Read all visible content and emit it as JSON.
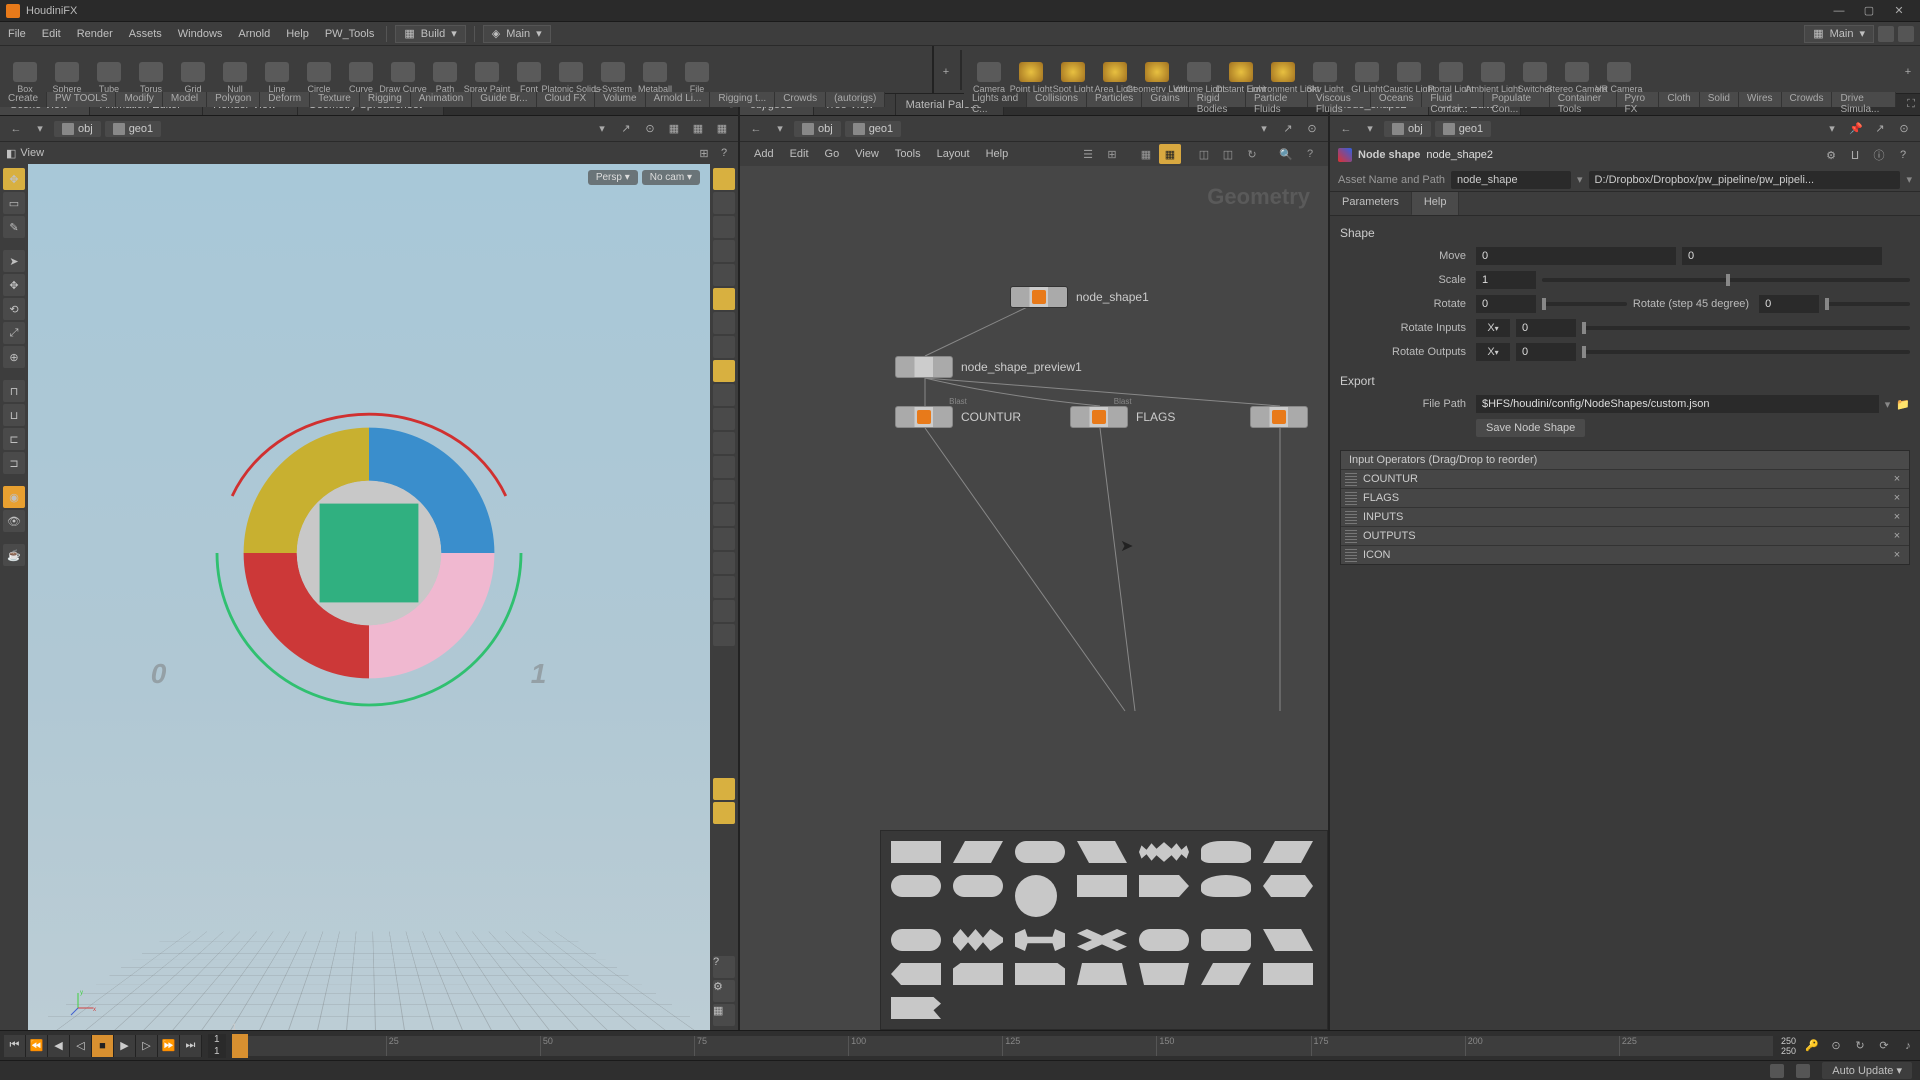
{
  "app": {
    "title": "HoudiniFX"
  },
  "window": {
    "minimize": "—",
    "maximize": "▢",
    "close": "✕"
  },
  "menus": [
    "File",
    "Edit",
    "Render",
    "Assets",
    "Windows",
    "Arnold",
    "Help",
    "PW_Tools"
  ],
  "desktops": {
    "left": "Build",
    "right": "Main",
    "far_right": "Main"
  },
  "shelves": {
    "left_tabs": [
      "Create",
      "PW TOOLS",
      "Modify",
      "Model",
      "Polygon",
      "Deform",
      "Texture",
      "Rigging",
      "Animation",
      "Guide Br...",
      "Cloud FX",
      "Volume",
      "Arnold Li...",
      "Rigging t...",
      "Crowds",
      "(autorigs)"
    ],
    "left_tools": [
      {
        "k": "box",
        "label": "Box"
      },
      {
        "k": "sphere",
        "label": "Sphere"
      },
      {
        "k": "tube",
        "label": "Tube"
      },
      {
        "k": "torus",
        "label": "Torus"
      },
      {
        "k": "grid",
        "label": "Grid"
      },
      {
        "k": "null",
        "label": "Null"
      },
      {
        "k": "line",
        "label": "Line"
      },
      {
        "k": "circle",
        "label": "Circle"
      },
      {
        "k": "curve",
        "label": "Curve"
      },
      {
        "k": "drawcurve",
        "label": "Draw Curve"
      },
      {
        "k": "path",
        "label": "Path"
      },
      {
        "k": "spraypaint",
        "label": "Spray Paint"
      },
      {
        "k": "font",
        "label": "Font"
      },
      {
        "k": "platonic",
        "label": "Platonic Solids"
      },
      {
        "k": "lsystem",
        "label": "L-System"
      },
      {
        "k": "metaball",
        "label": "Metaball"
      },
      {
        "k": "file",
        "label": "File"
      }
    ],
    "right_tabs": [
      "Lights and C...",
      "Collisions",
      "Particles",
      "Grains",
      "Rigid Bodies",
      "Particle Fluids",
      "Viscous Fluids",
      "Oceans",
      "Fluid Contai...",
      "Populate Con...",
      "Container Tools",
      "Pyro FX",
      "Cloth",
      "Solid",
      "Wires",
      "Crowds",
      "Drive Simula..."
    ],
    "right_tools": [
      {
        "k": "camera",
        "label": "Camera"
      },
      {
        "k": "pointlight",
        "label": "Point Light",
        "hl": true
      },
      {
        "k": "spotlight",
        "label": "Spot Light",
        "hl": true
      },
      {
        "k": "arealight",
        "label": "Area Light",
        "hl": true
      },
      {
        "k": "geolight",
        "label": "Geometry Light",
        "hl": true
      },
      {
        "k": "volumelight",
        "label": "Volume Light"
      },
      {
        "k": "distantlight",
        "label": "Distant Light",
        "hl": true
      },
      {
        "k": "envlight",
        "label": "Environment Light",
        "hl": true
      },
      {
        "k": "skylight",
        "label": "Sky Light"
      },
      {
        "k": "gilight",
        "label": "GI Light"
      },
      {
        "k": "causticlight",
        "label": "Caustic Light"
      },
      {
        "k": "portallight",
        "label": "Portal Light"
      },
      {
        "k": "ambientlight",
        "label": "Ambient Light"
      },
      {
        "k": "switcher",
        "label": "Switcher"
      },
      {
        "k": "stereocam",
        "label": "Stereo Camera"
      },
      {
        "k": "vrcamera",
        "label": "VR Camera"
      }
    ]
  },
  "tabs_left": [
    "Scene View",
    "Animation Editor",
    "Render View",
    "Geometry Spreadsheet"
  ],
  "tabs_mid": [
    "obj/geo1",
    "Tree View",
    "Material Palette"
  ],
  "tabs_right": [
    "node_shape2",
    "Script Editor"
  ],
  "path_left": {
    "seg1": "obj",
    "seg2": "geo1"
  },
  "path_mid": {
    "seg1": "obj",
    "seg2": "geo1"
  },
  "path_right": {
    "seg1": "obj",
    "seg2": "geo1"
  },
  "scene": {
    "view_label": "View",
    "persp": "Persp ▾",
    "nocam": "No cam ▾",
    "label0": "0",
    "label1": "1"
  },
  "network": {
    "menus": [
      "Add",
      "Edit",
      "Go",
      "View",
      "Tools",
      "Layout",
      "Help"
    ],
    "watermark": "Geometry",
    "nodes": {
      "n1": "node_shape1",
      "n2": "node_shape_preview1",
      "n3": "COUNTUR",
      "n4": "FLAGS",
      "sub3": "Blast",
      "sub4": "Blast"
    }
  },
  "parm": {
    "type": "Node shape",
    "name": "node_shape2",
    "anp_label": "Asset Name and Path",
    "asset_name": "node_shape",
    "asset_path": "D:/Dropbox/Dropbox/pw_pipeline/pw_pipeli...",
    "tabs": [
      "Parameters",
      "Help"
    ],
    "sec_shape": "Shape",
    "row_move": "Move",
    "move_x": "0",
    "move_y": "0",
    "row_scale": "Scale",
    "scale_v": "1",
    "row_rotate": "Rotate",
    "rotate_v": "0",
    "rotate_step_lbl": "Rotate (step 45 degree)",
    "rotate_step_v": "0",
    "row_rotin": "Rotate Inputs",
    "rotin_axis": "X",
    "rotin_v": "0",
    "row_rotout": "Rotate Outputs",
    "rotout_axis": "X",
    "rotout_v": "0",
    "sec_export": "Export",
    "row_filepath": "File Path",
    "filepath_v": "$HFS/houdini/config/NodeShapes/custom.json",
    "btn_save": "Save Node Shape",
    "inputops_hdr": "Input Operators (Drag/Drop to reorder)",
    "inputops": [
      "COUNTUR",
      "FLAGS",
      "INPUTS",
      "OUTPUTS",
      "ICON"
    ]
  },
  "timeline": {
    "frame": "1",
    "frame2": "1",
    "cursor": "1",
    "ticks": [
      "25",
      "50",
      "75",
      "100",
      "125",
      "150",
      "175",
      "200",
      "225"
    ],
    "end1": "250",
    "end2": "250"
  },
  "status": {
    "autoupdate": "Auto Update"
  }
}
